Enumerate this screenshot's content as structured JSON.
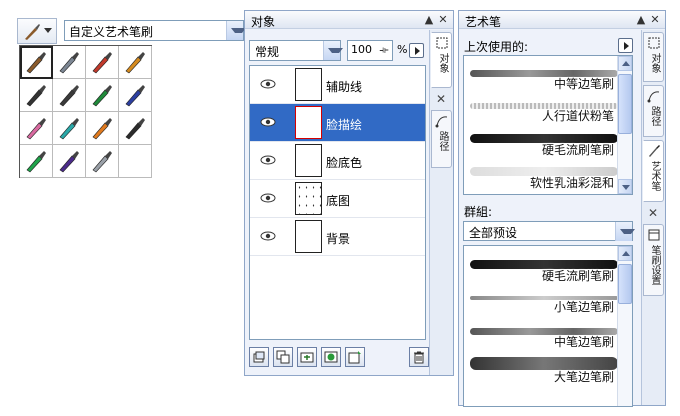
{
  "brush_selector": {
    "button_icon": "brush-icon",
    "combo_value": "自定义艺术笔刷",
    "grid": [
      {
        "icon": "flat-brush-icon",
        "selected": true,
        "color": "#8a5a2b"
      },
      {
        "icon": "airbrush-icon",
        "selected": false,
        "color": "#7d8794"
      },
      {
        "icon": "spray-can-icon",
        "selected": false,
        "color": "#c0392b"
      },
      {
        "icon": "pen-nib-icon",
        "selected": false,
        "color": "#d48a1f"
      },
      {
        "icon": "ink-pen-icon",
        "selected": false,
        "color": "#333333"
      },
      {
        "icon": "calligraphy-pen-icon",
        "selected": false,
        "color": "#3a3a3a"
      },
      {
        "icon": "green-marker-icon",
        "selected": false,
        "color": "#1f8a3a"
      },
      {
        "icon": "blue-pen-icon",
        "selected": false,
        "color": "#2c3fa0"
      },
      {
        "icon": "pink-marker-icon",
        "selected": false,
        "color": "#d86aa0"
      },
      {
        "icon": "teal-marker-icon",
        "selected": false,
        "color": "#2aa8a8"
      },
      {
        "icon": "orange-brush-icon",
        "selected": false,
        "color": "#e07a1f"
      },
      {
        "icon": "dark-marker-icon",
        "selected": false,
        "color": "#2b2b2b"
      },
      {
        "icon": "green-highlighter-icon",
        "selected": false,
        "color": "#1fa34a"
      },
      {
        "icon": "ink-drop-icon",
        "selected": false,
        "color": "#4b2b8a"
      },
      {
        "icon": "silver-nib-icon",
        "selected": false,
        "color": "#9aa0a8"
      },
      {
        "icon": "empty-slot",
        "selected": false,
        "color": "#ffffff"
      }
    ]
  },
  "objects_panel": {
    "title": "对象",
    "blend_mode": "常规",
    "opacity": "100",
    "opacity_unit": "%",
    "layers": [
      {
        "name": "辅助线",
        "visible": true,
        "active": false,
        "thumb": "plain"
      },
      {
        "name": "脸描绘",
        "visible": true,
        "active": true,
        "thumb": "plain"
      },
      {
        "name": "脸底色",
        "visible": true,
        "active": false,
        "thumb": "plain"
      },
      {
        "name": "底图",
        "visible": true,
        "active": false,
        "thumb": "dots"
      },
      {
        "name": "背景",
        "visible": true,
        "active": false,
        "thumb": "plain"
      }
    ],
    "bottom_buttons": [
      "new-layer-icon",
      "copy-layer-icon",
      "merge-layer-icon",
      "mask-icon",
      "new-object-icon"
    ],
    "tabs": [
      "对象",
      "路径"
    ],
    "close_glyph": "✕"
  },
  "art_brush_panel": {
    "title": "艺术笔",
    "recent_label": "上次使用的:",
    "recent_strokes": [
      {
        "label": "中等边笔刷",
        "style": "medium"
      },
      {
        "label": "人行道伏粉笔",
        "style": "chalk"
      },
      {
        "label": "硬毛流刷笔刷",
        "style": "bold"
      },
      {
        "label": "软性乳油彩混和",
        "style": "soft"
      }
    ],
    "group_label": "群組:",
    "group_value": "全部预设",
    "group_strokes": [
      {
        "label": "硬毛流刷笔刷",
        "style": "bold"
      },
      {
        "label": "小笔边笔刷",
        "style": "thin"
      },
      {
        "label": "中笔边笔刷",
        "style": "medium"
      },
      {
        "label": "大笔边笔刷",
        "style": "large"
      }
    ],
    "tabs": [
      "对象",
      "路径",
      "艺术笔",
      "笔刷设置"
    ],
    "close_glyph": "✕"
  },
  "window_buttons": {
    "collapse": "▲",
    "close": "✕"
  }
}
